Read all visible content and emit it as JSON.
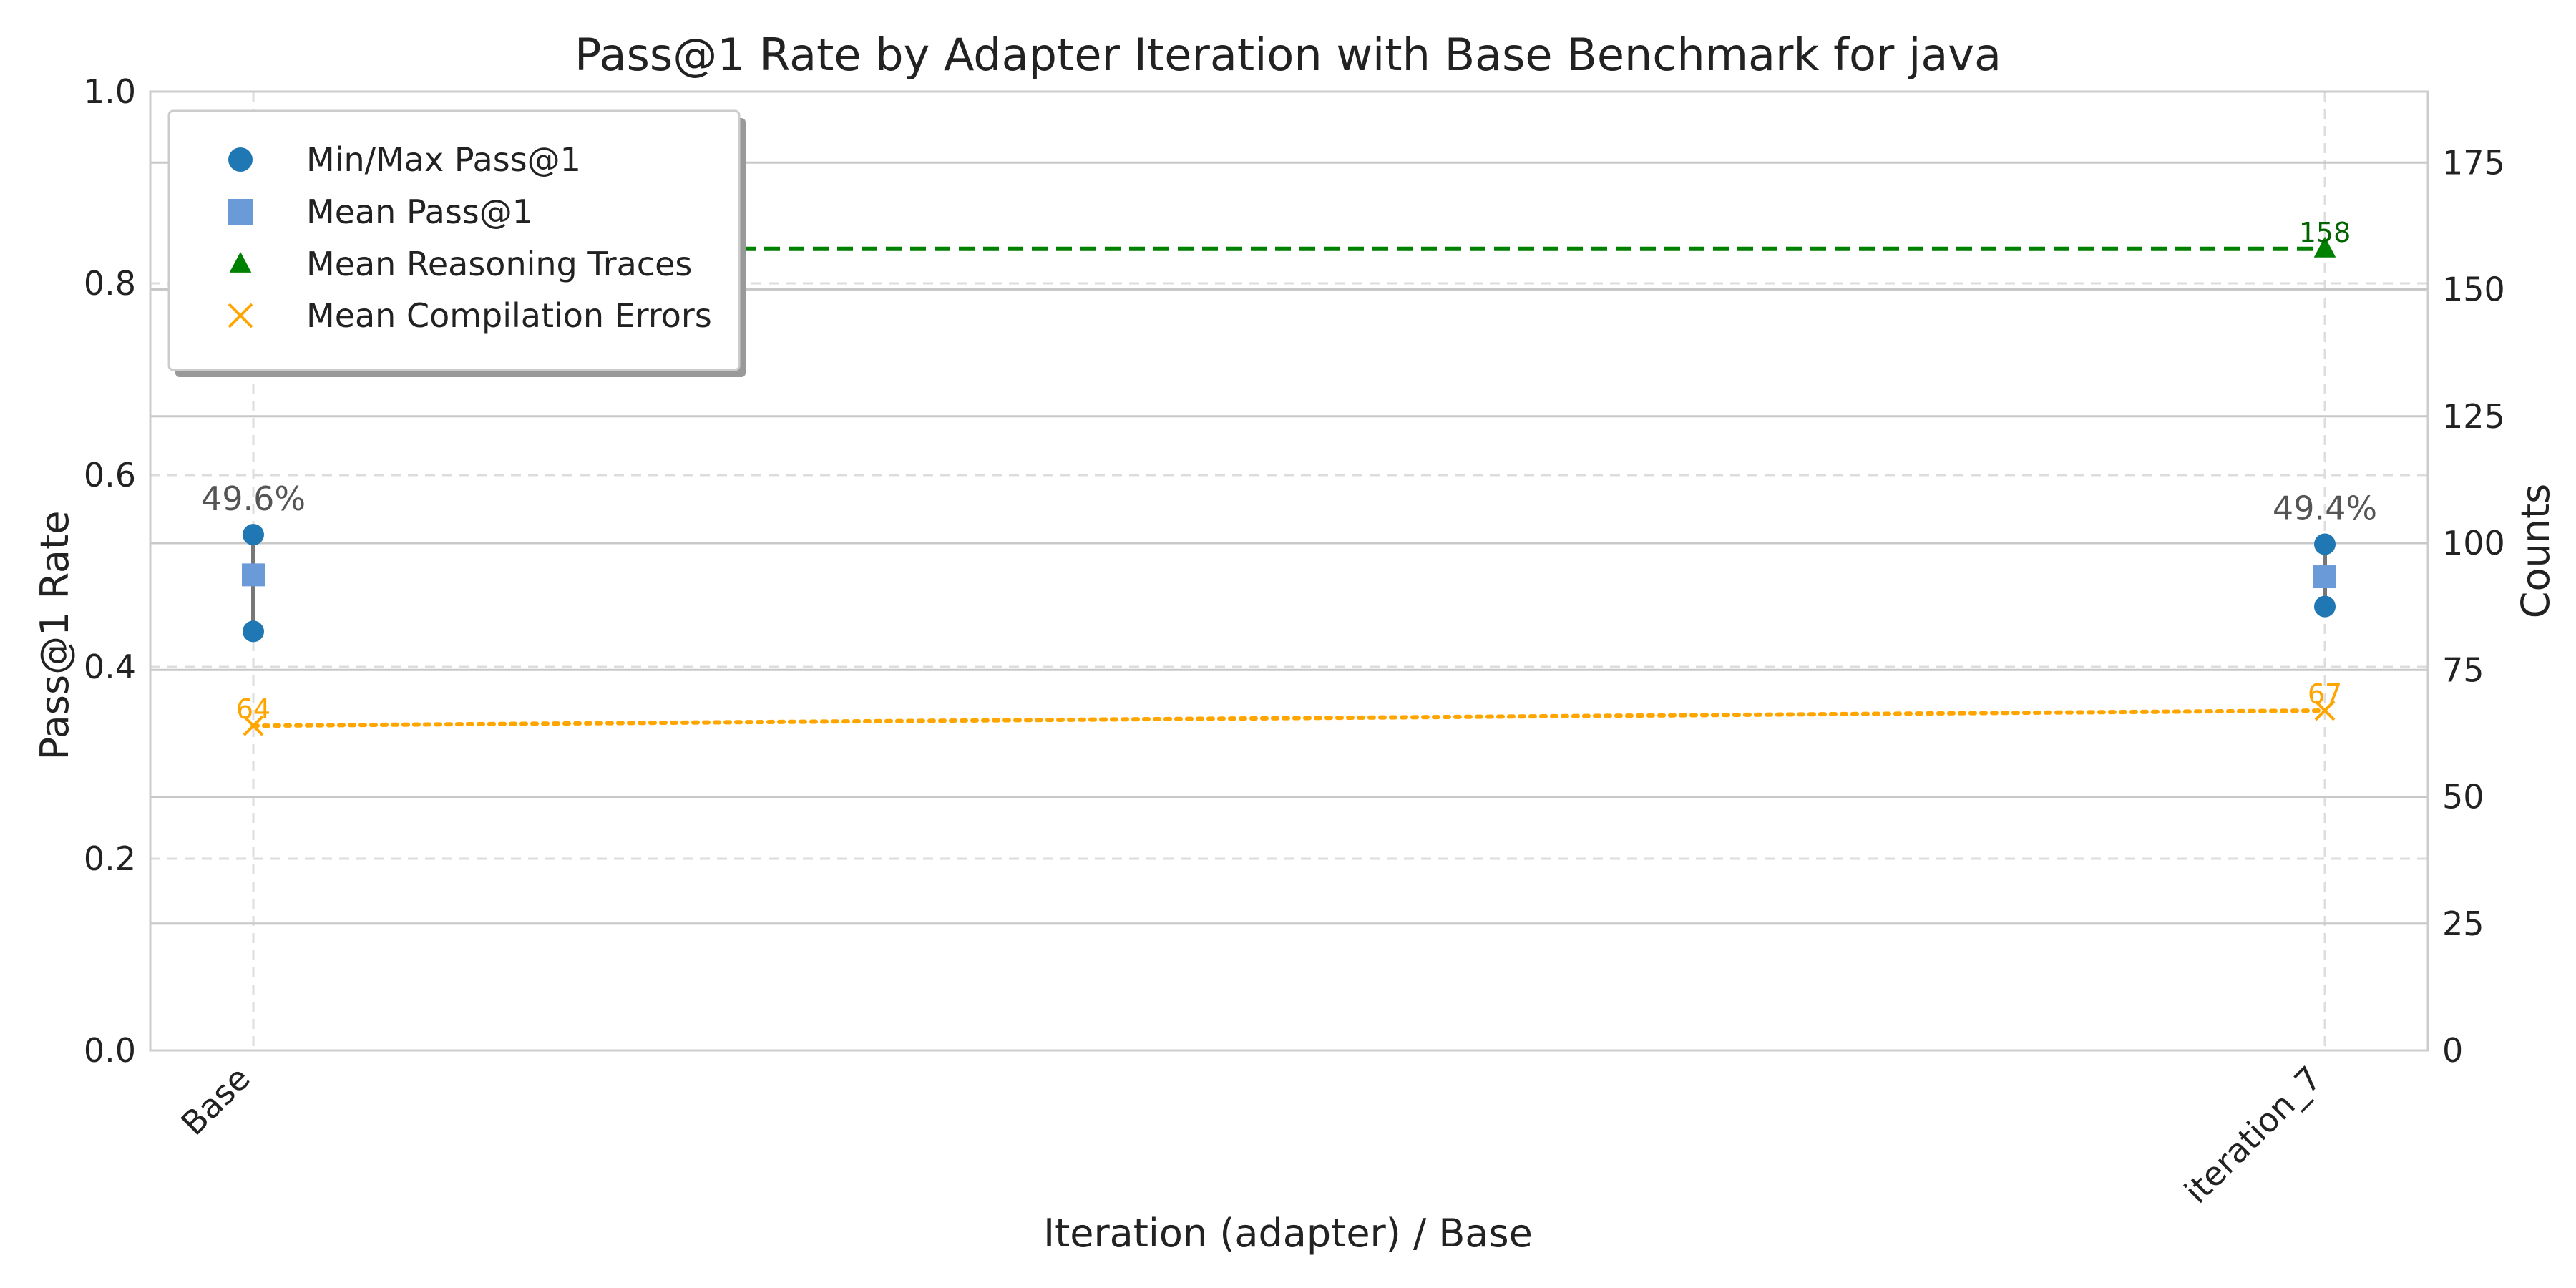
{
  "chart_data": {
    "type": "line",
    "title": "Pass@1 Rate by Adapter Iteration with Base Benchmark for java",
    "xlabel": "Iteration (adapter) / Base",
    "ylabel": "Pass@1 Rate",
    "y2label": "Counts",
    "categories": [
      "Base",
      "iteration_7"
    ],
    "ylim": [
      0.0,
      1.0
    ],
    "y2lim": [
      0,
      189
    ],
    "yticks": [
      "0.0",
      "0.2",
      "0.4",
      "0.6",
      "0.8",
      "1.0"
    ],
    "y2ticks": [
      "0",
      "25",
      "50",
      "75",
      "100",
      "125",
      "150",
      "175"
    ],
    "grid": true,
    "legend_position": "top-left",
    "series": [
      {
        "name": "Min/Max Pass@1",
        "axis": "left",
        "min": [
          0.437,
          0.463
        ],
        "max": [
          0.538,
          0.528
        ],
        "color": "#1f77b4",
        "marker": "circle"
      },
      {
        "name": "Mean Pass@1",
        "axis": "left",
        "values": [
          0.496,
          0.494
        ],
        "value_labels": [
          "49.6%",
          "49.4%"
        ],
        "color": "#6a9bd8",
        "marker": "square"
      },
      {
        "name": "Mean Reasoning Traces",
        "axis": "right",
        "values": [
          158,
          158
        ],
        "value_labels": [
          "158",
          "158"
        ],
        "color": "#008000",
        "marker": "triangle",
        "line_style": "dashed"
      },
      {
        "name": "Mean Compilation Errors",
        "axis": "right",
        "values": [
          64,
          67
        ],
        "value_labels": [
          "64",
          "67"
        ],
        "color": "#ffa500",
        "marker": "x",
        "line_style": "dotted"
      }
    ]
  }
}
